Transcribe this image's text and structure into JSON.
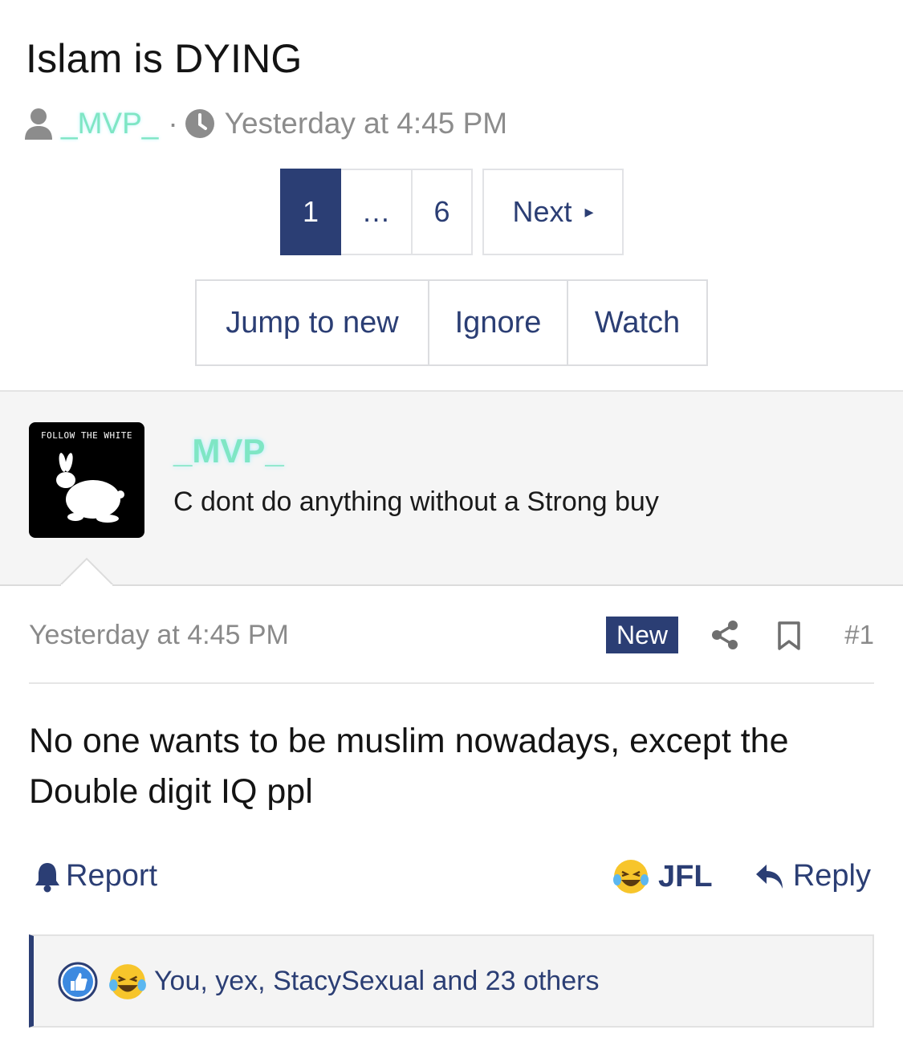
{
  "thread": {
    "title": "Islam is DYING",
    "author": "_MVP_",
    "separator": "·",
    "posted": "Yesterday at 4:45 PM"
  },
  "pagination": {
    "current": "1",
    "ellipsis": "…",
    "last": "6",
    "next_label": "Next",
    "next_caret": "▸"
  },
  "thread_actions": {
    "jump_label": "Jump to new",
    "ignore_label": "Ignore",
    "watch_label": "Watch"
  },
  "user_panel": {
    "avatar_text": "FOLLOW THE WHITE",
    "username": "_MVP_",
    "signature": "C dont do anything without a Strong buy"
  },
  "post": {
    "time": "Yesterday at 4:45 PM",
    "badge": "New",
    "number": "#1",
    "body": "No one wants to be muslim nowadays, except the Double digit IQ ppl",
    "report_label": "Report",
    "reaction_label": "JFL",
    "reply_label": "Reply",
    "reactors": "You, yex, StacySexual and 23 others"
  },
  "colors": {
    "accent": "#2b3e74",
    "username": "#7fe6c4",
    "muted": "#8a8a8a",
    "panel_bg": "#f5f5f5"
  },
  "icons": [
    "user-icon",
    "clock-icon",
    "share-icon",
    "bookmark-icon",
    "bell-icon",
    "laughing-emoji-icon",
    "reply-arrow-icon",
    "like-icon"
  ]
}
